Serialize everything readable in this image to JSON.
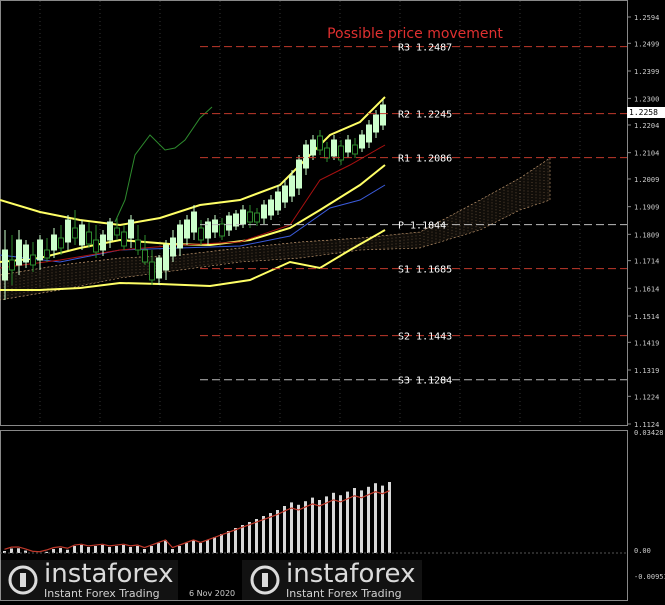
{
  "title": "Possible price movement",
  "price_tag": "1.2258",
  "price_axis": [
    "1.2594",
    "1.2499",
    "1.2399",
    "1.2300",
    "1.2204",
    "1.2104",
    "1.2009",
    "1.1909",
    "1.1809",
    "1.1714",
    "1.1614",
    "1.1514",
    "1.1419",
    "1.1319",
    "1.1224",
    "1.1124"
  ],
  "indicator_axis": [
    "0.03428",
    "0.00",
    "-0.00951"
  ],
  "levels": [
    {
      "label": "R3 1.2487",
      "price": 1.2487,
      "color": "#c0392b"
    },
    {
      "label": "R2 1.2245",
      "price": 1.2245,
      "color": "#c0392b"
    },
    {
      "label": "R1 1.2086",
      "price": 1.2086,
      "color": "#c0392b"
    },
    {
      "label": "P 1.1844",
      "price": 1.1844,
      "color": "#bbbbbb"
    },
    {
      "label": "S1 1.1685",
      "price": 1.1685,
      "color": "#c0392b"
    },
    {
      "label": "S2 1.1443",
      "price": 1.1443,
      "color": "#c0392b"
    },
    {
      "label": "S3 1.1284",
      "price": 1.1284,
      "color": "#bbbbbb"
    }
  ],
  "date_label": "6 Nov 2020",
  "watermark": {
    "brand": "instaforex",
    "sub": "Instant Forex Trading"
  },
  "colors": {
    "bull": "#ccffcc",
    "bear": "#2e8b2e",
    "band": "#ffff66",
    "cloud": "#d2a679",
    "title": "#e03030",
    "level": "#c0392b",
    "hist": "#d8d8d8",
    "signal": "#c0392b"
  }
}
